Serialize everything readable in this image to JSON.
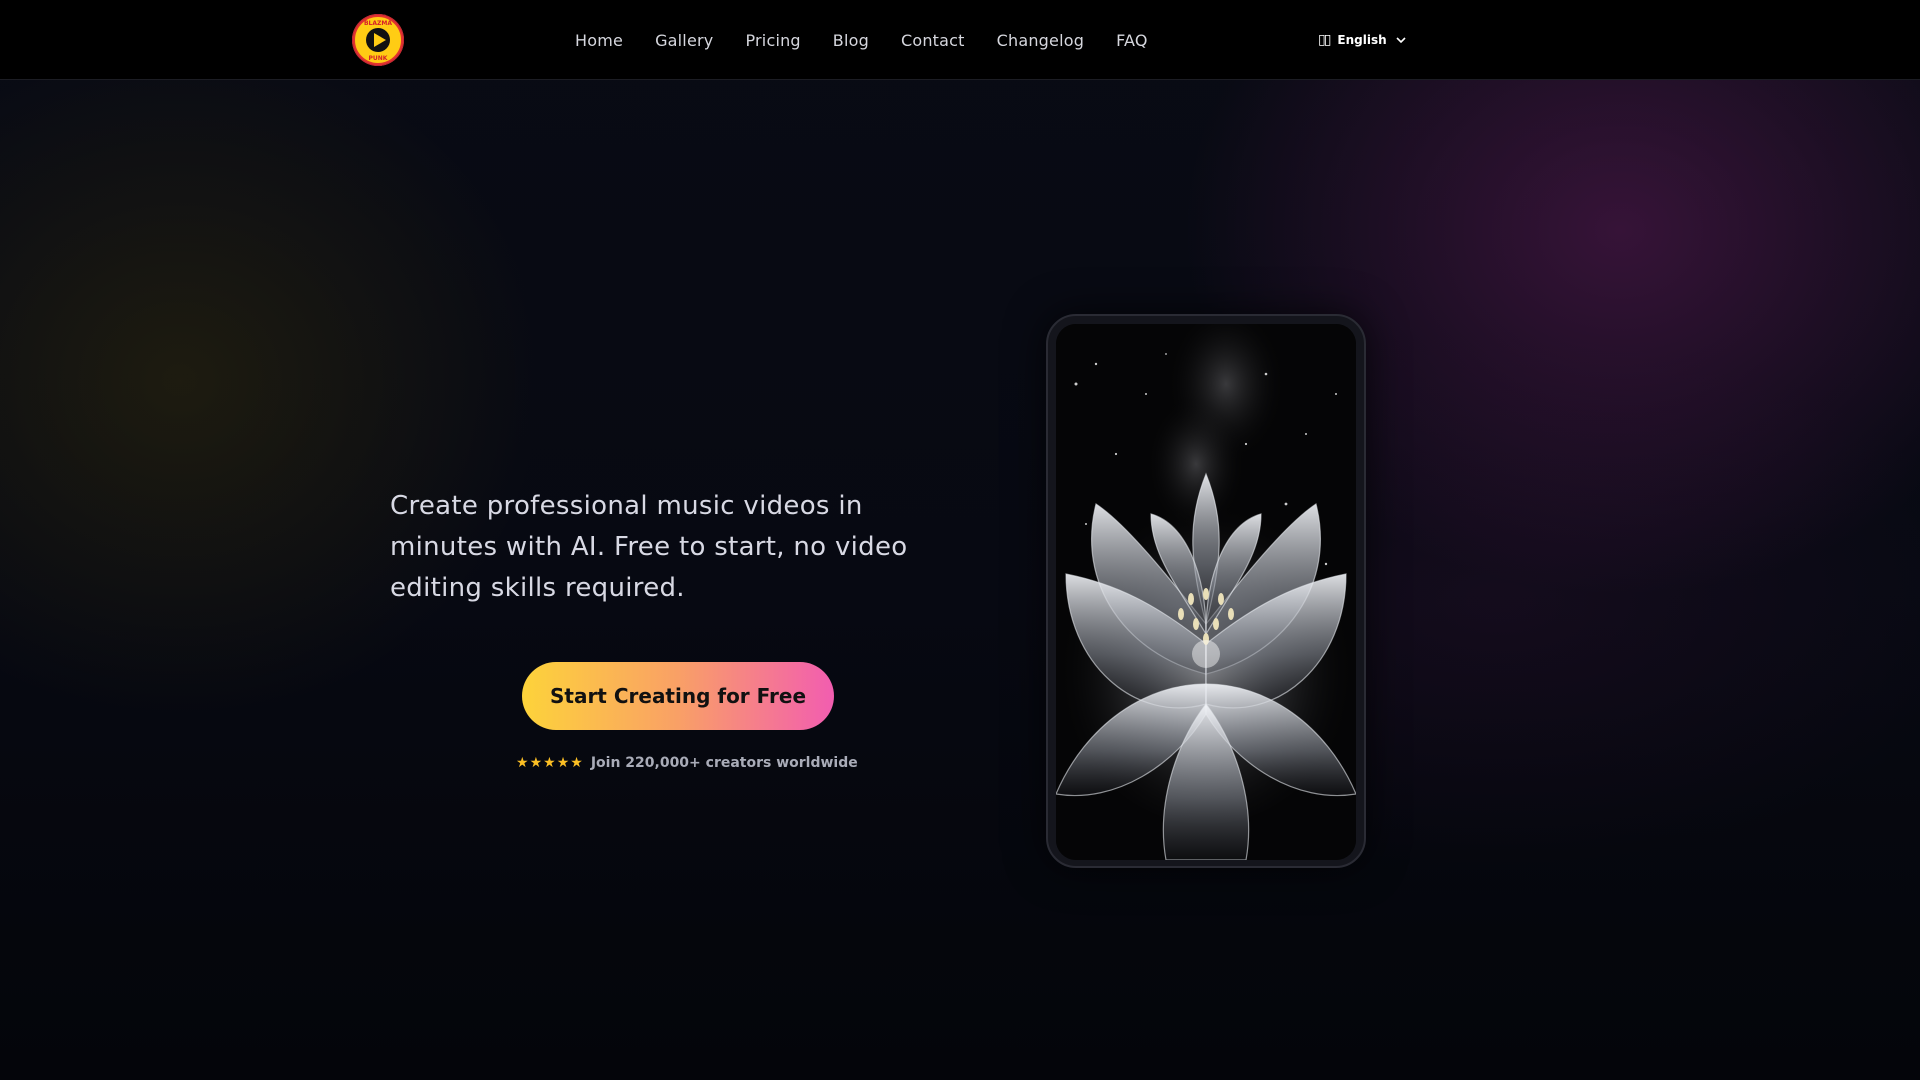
{
  "nav": {
    "logo": {
      "icon": "play-icon",
      "text": "BLAZMA PUNK"
    },
    "links": [
      "Home",
      "Gallery",
      "Pricing",
      "Blog",
      "Contact",
      "Changelog",
      "FAQ"
    ],
    "language": {
      "icon": "language-icon",
      "label": "English"
    }
  },
  "hero": {
    "headline": "Create professional music videos in minutes with AI. Free to start, no video editing skills required.",
    "cta_label": "Start Creating for Free",
    "rating": 5,
    "social_proof": "Join 220,000+ creators worldwide"
  },
  "preview": {
    "image": "crystal-flower-video-preview"
  },
  "colors": {
    "cta_start": "#fdd33a",
    "cta_end": "#f25db0",
    "star": "#fbbf24",
    "logo": "#ffd21f"
  }
}
